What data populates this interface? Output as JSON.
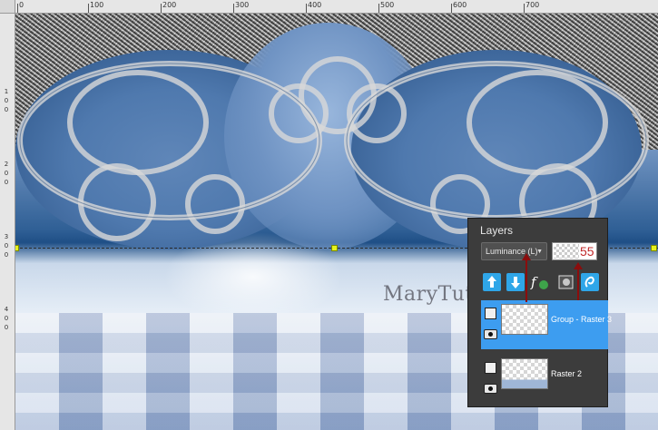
{
  "ruler": {
    "top_labels": [
      "0",
      "100",
      "200",
      "300",
      "400",
      "500",
      "600",
      "700"
    ],
    "left_labels": [
      "1",
      "0",
      "0",
      "2",
      "0",
      "0",
      "3",
      "0",
      "0",
      "4",
      "0",
      "0"
    ]
  },
  "canvas": {
    "watermark": "MaryTutorials",
    "watermark_mark": "©"
  },
  "layers_panel": {
    "title": "Layers",
    "blend_mode": "Luminance (L)",
    "opacity": "55",
    "layers": [
      {
        "name": "Group - Raster 3",
        "selected": true
      },
      {
        "name": "Raster 2",
        "selected": false
      }
    ]
  },
  "colors": {
    "selection": "#3d9df0",
    "opacity_text": "#c0282a",
    "panel_bg": "#3c3c3c",
    "guide_handle": "#e7f21c",
    "arrow": "#8b0d0d"
  },
  "icons": [
    "new-layer-icon",
    "merge-down-icon",
    "fx-effects-icon",
    "mask-icon",
    "link-icon",
    "group-icon",
    "eye-icon",
    "layer-type-icon"
  ]
}
